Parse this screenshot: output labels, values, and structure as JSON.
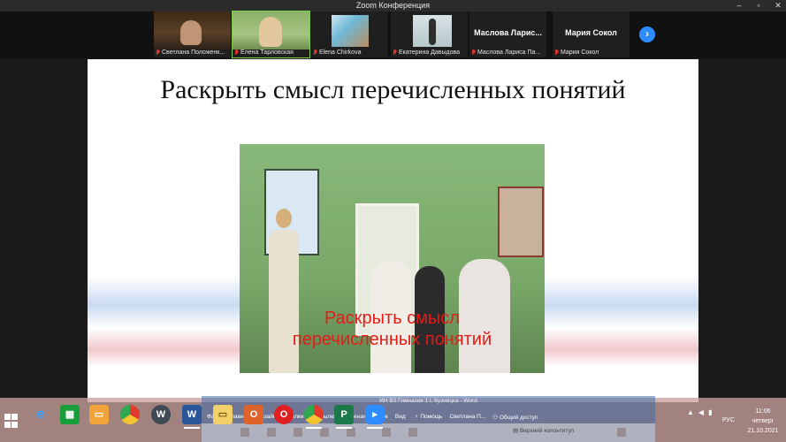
{
  "window": {
    "title": "Zoom Конференция"
  },
  "colors": {
    "accent": "#2d8cff",
    "speaker_highlight": "#7fd14a",
    "muted_mic": "#e0322e",
    "caption_red": "#e41b17"
  },
  "participants": [
    {
      "name": "Светлана Положенк...",
      "muted": true
    },
    {
      "name": "Елена Тарловская",
      "muted": true,
      "active_speaker": true
    },
    {
      "name": "Elena Chirkova",
      "muted": true
    },
    {
      "name": "Екатерина Давыдова",
      "muted": true
    },
    {
      "big_label": "Маслова  Ларис...",
      "name": "Маслова Лариса Па...",
      "muted": true
    },
    {
      "big_label": "Мария Сокол",
      "name": "Мария Сокол",
      "muted": true
    }
  ],
  "next_button_icon": "chevron-right-icon",
  "slide": {
    "title": "Раскрыть смысл перечисленных понятий",
    "caption_line1": "Раскрыть смысл",
    "caption_line2": "перечисленных понятий"
  },
  "word": {
    "title": "ИН ВЗ Гимназия 1 г. Кузнецка - Word",
    "tabs": [
      "Файл",
      "Главная",
      "",
      "Дизайн",
      "",
      "Ссылки",
      "Рассылки",
      "Рецензирование",
      "Вид"
    ],
    "tell_me": "Помощь",
    "user": "Светлана П...",
    "share": "Общий доступ",
    "ribbon_item": "Верхний колонтитул"
  },
  "taskbar": {
    "apps": [
      "ie-icon",
      "store-icon",
      "files-icon",
      "chrome-icon",
      "wordpress-icon",
      "word-icon",
      "explorer-icon",
      "office-icon",
      "opera-icon",
      "chrome-alt-icon",
      "publisher-icon",
      "zoom-icon"
    ]
  },
  "tray": {
    "language": "РУС",
    "time": "11:06",
    "day": "четверг",
    "date": "21.10.2021"
  }
}
